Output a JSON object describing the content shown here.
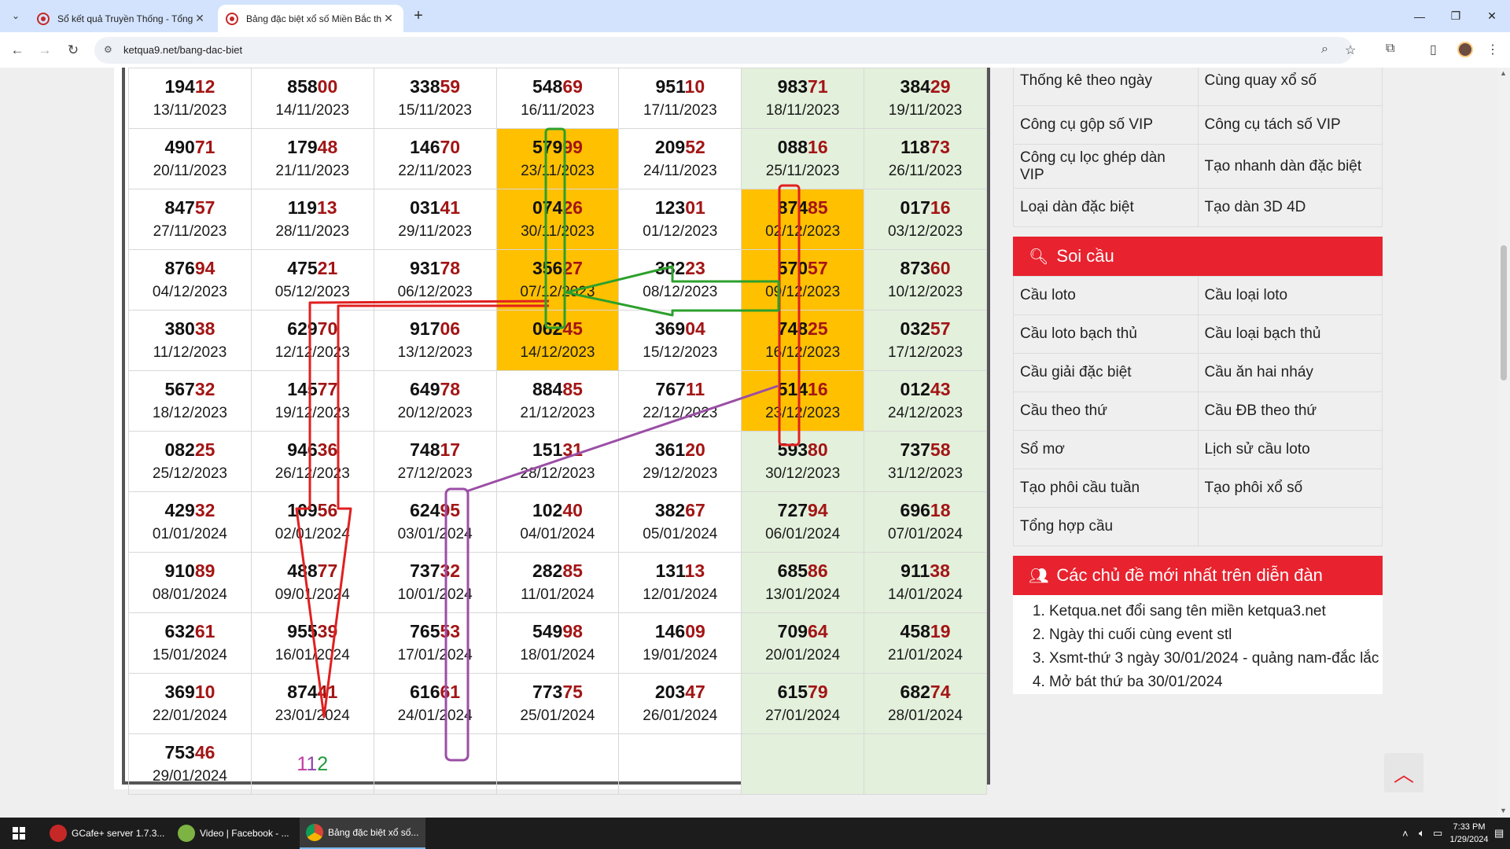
{
  "browser": {
    "tabs": [
      {
        "title": "Sổ kết quả Truyền Thống - Tổng"
      },
      {
        "title": "Bảng đặc biệt xổ số Miền Bắc th"
      }
    ],
    "url": "ketqua9.net/bang-dac-biet"
  },
  "table": {
    "rows": [
      [
        {
          "p": "194",
          "l": "12",
          "d": "13/11/2023",
          "c": ""
        },
        {
          "p": "858",
          "l": "00",
          "d": "14/11/2023",
          "c": ""
        },
        {
          "p": "338",
          "l": "59",
          "d": "15/11/2023",
          "c": ""
        },
        {
          "p": "548",
          "l": "69",
          "d": "16/11/2023",
          "c": ""
        },
        {
          "p": "951",
          "l": "10",
          "d": "17/11/2023",
          "c": ""
        },
        {
          "p": "983",
          "l": "71",
          "d": "18/11/2023",
          "c": "wk"
        },
        {
          "p": "384",
          "l": "29",
          "d": "19/11/2023",
          "c": "wk"
        }
      ],
      [
        {
          "p": "490",
          "l": "71",
          "d": "20/11/2023",
          "c": ""
        },
        {
          "p": "179",
          "l": "48",
          "d": "21/11/2023",
          "c": ""
        },
        {
          "p": "146",
          "l": "70",
          "d": "22/11/2023",
          "c": ""
        },
        {
          "p": "579",
          "l": "99",
          "d": "23/11/2023",
          "c": "hl"
        },
        {
          "p": "209",
          "l": "52",
          "d": "24/11/2023",
          "c": ""
        },
        {
          "p": "088",
          "l": "16",
          "d": "25/11/2023",
          "c": "wk"
        },
        {
          "p": "118",
          "l": "73",
          "d": "26/11/2023",
          "c": "wk"
        }
      ],
      [
        {
          "p": "847",
          "l": "57",
          "d": "27/11/2023",
          "c": ""
        },
        {
          "p": "119",
          "l": "13",
          "d": "28/11/2023",
          "c": ""
        },
        {
          "p": "031",
          "l": "41",
          "d": "29/11/2023",
          "c": ""
        },
        {
          "p": "074",
          "l": "26",
          "d": "30/11/2023",
          "c": "hl"
        },
        {
          "p": "123",
          "l": "01",
          "d": "01/12/2023",
          "c": ""
        },
        {
          "p": "874",
          "l": "85",
          "d": "02/12/2023",
          "c": "hl"
        },
        {
          "p": "017",
          "l": "16",
          "d": "03/12/2023",
          "c": "wk"
        }
      ],
      [
        {
          "p": "876",
          "l": "94",
          "d": "04/12/2023",
          "c": ""
        },
        {
          "p": "475",
          "l": "21",
          "d": "05/12/2023",
          "c": ""
        },
        {
          "p": "931",
          "l": "78",
          "d": "06/12/2023",
          "c": ""
        },
        {
          "p": "356",
          "l": "27",
          "d": "07/12/2023",
          "c": "hl"
        },
        {
          "p": "382",
          "l": "23",
          "d": "08/12/2023",
          "c": ""
        },
        {
          "p": "570",
          "l": "57",
          "d": "09/12/2023",
          "c": "hl"
        },
        {
          "p": "873",
          "l": "60",
          "d": "10/12/2023",
          "c": "wk"
        }
      ],
      [
        {
          "p": "380",
          "l": "38",
          "d": "11/12/2023",
          "c": ""
        },
        {
          "p": "629",
          "l": "70",
          "d": "12/12/2023",
          "c": ""
        },
        {
          "p": "917",
          "l": "06",
          "d": "13/12/2023",
          "c": ""
        },
        {
          "p": "062",
          "l": "45",
          "d": "14/12/2023",
          "c": "hl"
        },
        {
          "p": "369",
          "l": "04",
          "d": "15/12/2023",
          "c": ""
        },
        {
          "p": "748",
          "l": "25",
          "d": "16/12/2023",
          "c": "hl"
        },
        {
          "p": "032",
          "l": "57",
          "d": "17/12/2023",
          "c": "wk"
        }
      ],
      [
        {
          "p": "567",
          "l": "32",
          "d": "18/12/2023",
          "c": ""
        },
        {
          "p": "145",
          "l": "77",
          "d": "19/12/2023",
          "c": ""
        },
        {
          "p": "649",
          "l": "78",
          "d": "20/12/2023",
          "c": ""
        },
        {
          "p": "884",
          "l": "85",
          "d": "21/12/2023",
          "c": ""
        },
        {
          "p": "767",
          "l": "11",
          "d": "22/12/2023",
          "c": ""
        },
        {
          "p": "514",
          "l": "16",
          "d": "23/12/2023",
          "c": "hl"
        },
        {
          "p": "012",
          "l": "43",
          "d": "24/12/2023",
          "c": "wk"
        }
      ],
      [
        {
          "p": "082",
          "l": "25",
          "d": "25/12/2023",
          "c": ""
        },
        {
          "p": "946",
          "l": "36",
          "d": "26/12/2023",
          "c": ""
        },
        {
          "p": "748",
          "l": "17",
          "d": "27/12/2023",
          "c": ""
        },
        {
          "p": "151",
          "l": "31",
          "d": "28/12/2023",
          "c": ""
        },
        {
          "p": "361",
          "l": "20",
          "d": "29/12/2023",
          "c": ""
        },
        {
          "p": "593",
          "l": "80",
          "d": "30/12/2023",
          "c": "wk"
        },
        {
          "p": "737",
          "l": "58",
          "d": "31/12/2023",
          "c": "wk"
        }
      ],
      [
        {
          "p": "429",
          "l": "32",
          "d": "01/01/2024",
          "c": ""
        },
        {
          "p": "109",
          "l": "56",
          "d": "02/01/2024",
          "c": ""
        },
        {
          "p": "624",
          "l": "95",
          "d": "03/01/2024",
          "c": ""
        },
        {
          "p": "102",
          "l": "40",
          "d": "04/01/2024",
          "c": ""
        },
        {
          "p": "382",
          "l": "67",
          "d": "05/01/2024",
          "c": ""
        },
        {
          "p": "727",
          "l": "94",
          "d": "06/01/2024",
          "c": "wk"
        },
        {
          "p": "696",
          "l": "18",
          "d": "07/01/2024",
          "c": "wk"
        }
      ],
      [
        {
          "p": "910",
          "l": "89",
          "d": "08/01/2024",
          "c": ""
        },
        {
          "p": "488",
          "l": "77",
          "d": "09/01/2024",
          "c": ""
        },
        {
          "p": "737",
          "l": "32",
          "d": "10/01/2024",
          "c": ""
        },
        {
          "p": "282",
          "l": "85",
          "d": "11/01/2024",
          "c": ""
        },
        {
          "p": "131",
          "l": "13",
          "d": "12/01/2024",
          "c": ""
        },
        {
          "p": "685",
          "l": "86",
          "d": "13/01/2024",
          "c": "wk"
        },
        {
          "p": "911",
          "l": "38",
          "d": "14/01/2024",
          "c": "wk"
        }
      ],
      [
        {
          "p": "632",
          "l": "61",
          "d": "15/01/2024",
          "c": ""
        },
        {
          "p": "955",
          "l": "39",
          "d": "16/01/2024",
          "c": ""
        },
        {
          "p": "765",
          "l": "53",
          "d": "17/01/2024",
          "c": ""
        },
        {
          "p": "549",
          "l": "98",
          "d": "18/01/2024",
          "c": ""
        },
        {
          "p": "146",
          "l": "09",
          "d": "19/01/2024",
          "c": ""
        },
        {
          "p": "709",
          "l": "64",
          "d": "20/01/2024",
          "c": "wk"
        },
        {
          "p": "458",
          "l": "19",
          "d": "21/01/2024",
          "c": "wk"
        }
      ],
      [
        {
          "p": "369",
          "l": "10",
          "d": "22/01/2024",
          "c": ""
        },
        {
          "p": "874",
          "l": "41",
          "d": "23/01/2024",
          "c": ""
        },
        {
          "p": "616",
          "l": "61",
          "d": "24/01/2024",
          "c": ""
        },
        {
          "p": "773",
          "l": "75",
          "d": "25/01/2024",
          "c": ""
        },
        {
          "p": "203",
          "l": "47",
          "d": "26/01/2024",
          "c": ""
        },
        {
          "p": "615",
          "l": "79",
          "d": "27/01/2024",
          "c": "wk"
        },
        {
          "p": "682",
          "l": "74",
          "d": "28/01/2024",
          "c": "wk"
        }
      ],
      [
        {
          "p": "753",
          "l": "46",
          "d": "29/01/2024",
          "c": ""
        },
        {
          "pred": [
            "1",
            "1",
            "2"
          ],
          "c": ""
        },
        {
          "p": "",
          "l": "",
          "d": "",
          "c": ""
        },
        {
          "p": "",
          "l": "",
          "d": "",
          "c": ""
        },
        {
          "p": "",
          "l": "",
          "d": "",
          "c": ""
        },
        {
          "p": "",
          "l": "",
          "d": "",
          "c": "wk"
        },
        {
          "p": "",
          "l": "",
          "d": "",
          "c": "wk"
        }
      ]
    ]
  },
  "sidebar": {
    "links": [
      [
        "Thống kê theo ngày",
        "Cùng quay xổ số"
      ],
      [
        "Công cụ gộp số VIP",
        "Công cụ tách số VIP"
      ],
      [
        "Công cụ lọc ghép dàn VIP",
        "Tạo nhanh dàn đặc biệt"
      ],
      [
        "Loại dàn đặc biệt",
        "Tạo dàn 3D 4D"
      ]
    ],
    "soi_cau": {
      "title": "Soi cầu",
      "links": [
        [
          "Cầu loto",
          "Cầu loại loto"
        ],
        [
          "Cầu loto bạch thủ",
          "Cầu loại bạch thủ"
        ],
        [
          "Cầu giải đặc biệt",
          "Cầu ăn hai nháy"
        ],
        [
          "Cầu theo thứ",
          "Cầu ĐB theo thứ"
        ],
        [
          "Sổ mơ",
          "Lịch sử cầu loto"
        ],
        [
          "Tạo phôi cầu tuần",
          "Tạo phôi xổ số"
        ],
        [
          "Tổng hợp cầu",
          ""
        ]
      ]
    },
    "forum": {
      "title": "Các chủ đề mới nhất trên diễn đàn",
      "items": [
        "Ketqua.net đổi sang tên miền ketqua3.net",
        "Ngày thi cuối cùng event stl",
        "Xsmt-thứ 3 ngày 30/01/2024 - quảng nam-đắc lắc",
        "Mở bát thứ ba 30/01/2024"
      ]
    }
  },
  "taskbar": {
    "items": [
      "GCafe+ server 1.7.3...",
      "Video | Facebook - ...",
      "Bảng đặc biệt xổ số..."
    ],
    "time": "7:33 PM",
    "date": "1/29/2024"
  },
  "colors": {
    "highlight": "#ffc000",
    "weekend": "#e3f0dc",
    "accent_red": "#e8222e",
    "digit_red": "#a31515",
    "annot_red": "#e02020",
    "annot_green": "#2ca02c",
    "annot_purple": "#9b4ea6"
  }
}
